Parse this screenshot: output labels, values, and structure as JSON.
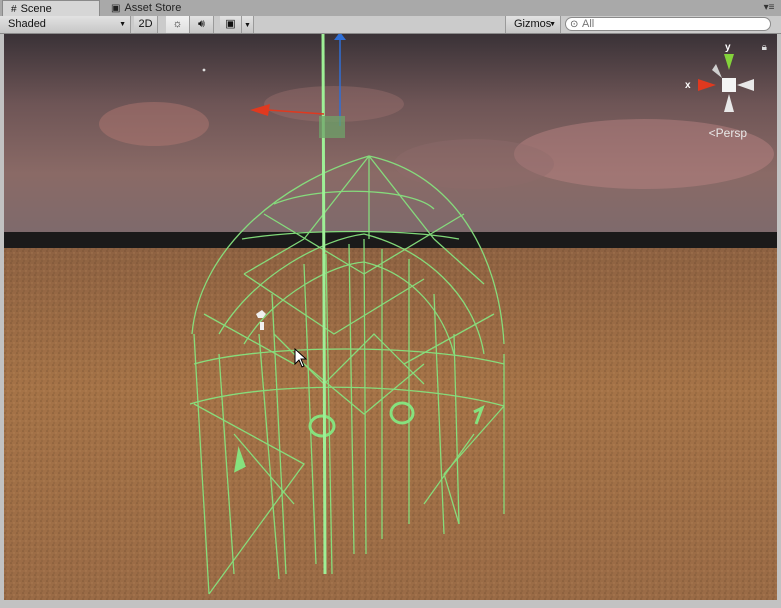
{
  "tabs": [
    {
      "label": "Scene",
      "icon": "grid-icon"
    },
    {
      "label": "Asset Store",
      "icon": "store-icon"
    }
  ],
  "toolbar": {
    "shading_mode": "Shaded",
    "mode_2d": "2D",
    "gizmos_label": "Gizmos",
    "search_placeholder": "All"
  },
  "gizmo": {
    "x_label": "x",
    "y_label": "y",
    "persp_label": "Persp"
  },
  "colors": {
    "wireframe": "#86e27e",
    "x_axis": "#e0391f",
    "y_axis": "#84d33b",
    "z_axis": "#2f6fd6",
    "sky_top": "#41383d",
    "ground": "#a06d42"
  }
}
